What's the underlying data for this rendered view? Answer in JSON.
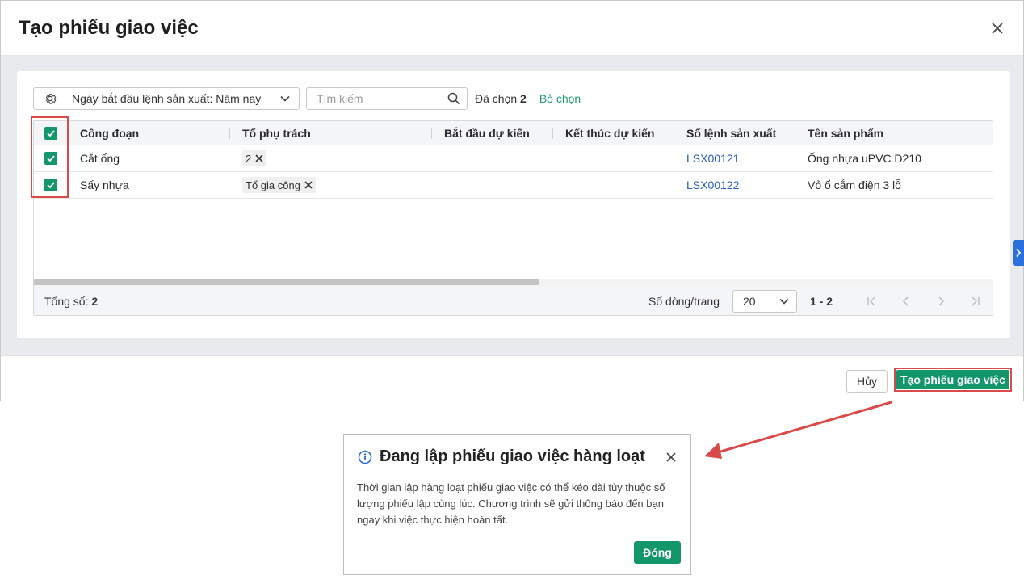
{
  "modal": {
    "title": "Tạo phiếu giao việc",
    "filter_label": "Ngày bắt đầu lệnh sản xuất: Năm nay",
    "search_placeholder": "Tìm kiếm",
    "selected_prefix": "Đã chọn",
    "selected_count": "2",
    "deselect_label": "Bỏ chọn",
    "columns": [
      "Công đoạn",
      "Tổ phụ trách",
      "Bắt đầu dự kiến",
      "Kết thúc dự kiến",
      "Số lệnh sản xuất",
      "Tên sản phẩm"
    ],
    "rows": [
      {
        "step": "Cắt ống",
        "team": "2",
        "start": "",
        "end": "",
        "order": "LSX00121",
        "product": "Ống nhựa uPVC D210",
        "checked": true
      },
      {
        "step": "Sấy nhựa",
        "team": "Tổ gia công",
        "start": "",
        "end": "",
        "order": "LSX00122",
        "product": "Vỏ ổ cắm điện 3 lỗ",
        "checked": true
      }
    ],
    "footer": {
      "total_label": "Tổng số:",
      "total_value": "2",
      "rows_per_page_label": "Số dòng/trang",
      "page_size": "20",
      "range": "1 - 2"
    },
    "cancel_label": "Hủy",
    "create_label": "Tạo phiếu giao việc"
  },
  "notification": {
    "title": "Đang lập phiếu giao việc hàng loạt",
    "message": "Thời gian lập hàng loạt phiếu giao việc có thể kéo dài tùy thuộc số lượng phiếu lập cùng lúc. Chương trình sẽ gửi thông báo đến bạn ngay khi việc thực hiện hoàn tất.",
    "ok_label": "Đóng"
  },
  "colors": {
    "primary_green": "#14966b",
    "link_blue": "#2a5ebd",
    "highlight_red": "#d94a4a",
    "info_blue": "#2a6fdb"
  },
  "icons": {
    "close": "close-icon",
    "settings": "gear-icon",
    "search": "search-icon",
    "dropdown": "chevron-down-icon",
    "info": "info-icon",
    "expand": "chevron-right-icon"
  }
}
